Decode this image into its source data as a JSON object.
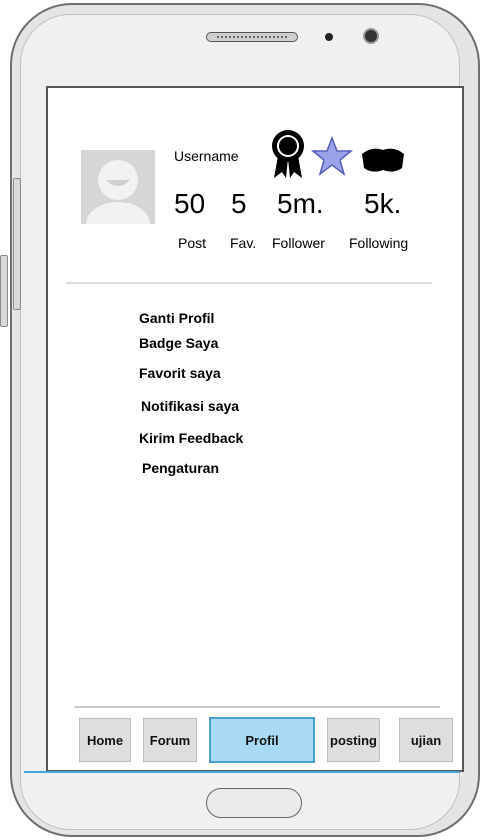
{
  "profile": {
    "username": "Username",
    "stats": [
      {
        "value": "50",
        "label": "Post"
      },
      {
        "value": "5",
        "label": "Fav."
      },
      {
        "value": "5m.",
        "label": "Follower"
      },
      {
        "value": "5k.",
        "label": "Following"
      }
    ],
    "badges": [
      "ribbon-badge-icon",
      "star-badge-icon",
      "shield-badge-icon"
    ]
  },
  "menu": {
    "items": [
      "Ganti Profil",
      "Badge Saya",
      "Favorit saya",
      "Notifikasi saya",
      "Kirim Feedback",
      "Pengaturan"
    ]
  },
  "nav": {
    "items": [
      "Home",
      "Forum",
      "Profil",
      "posting",
      "ujian"
    ],
    "active": "Profil"
  },
  "colors": {
    "active_tab": "#a9daf3",
    "active_border": "#4a9fd3",
    "accent_line": "#4aa7d6"
  }
}
